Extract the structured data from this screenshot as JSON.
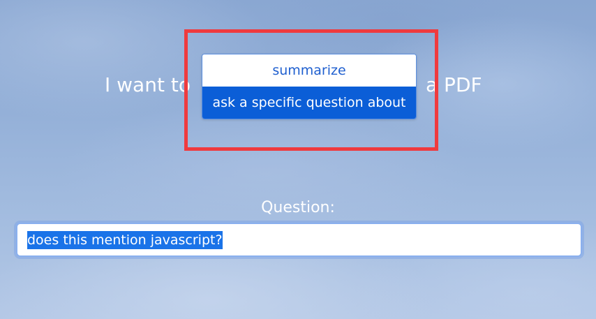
{
  "headline": {
    "prefix": "I want to",
    "suffix": "a PDF"
  },
  "dropdown": {
    "options": [
      {
        "label": "summarize"
      },
      {
        "label": "ask a specific question about"
      }
    ],
    "selected_index": 1
  },
  "question": {
    "label": "Question:",
    "value": "does this mention javascript?"
  },
  "colors": {
    "highlight_border": "#ef3a3e",
    "selected_option_bg": "#0b5ed7",
    "text_selection_bg": "#1a73e8"
  }
}
